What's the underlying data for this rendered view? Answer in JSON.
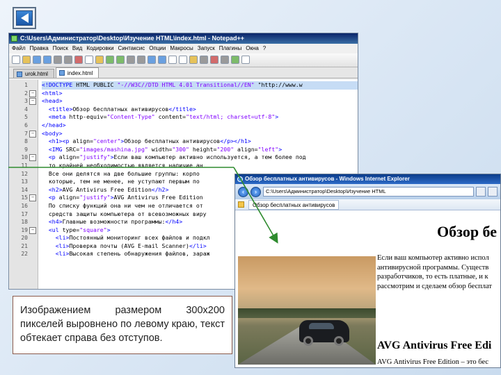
{
  "back_button": {
    "icon": "back-arrow-icon"
  },
  "notepad": {
    "title": "C:\\Users\\Администратор\\Desktop\\Изучение HTML\\index.html - Notepad++",
    "menu": [
      "Файл",
      "Правка",
      "Поиск",
      "Вид",
      "Кодировки",
      "Синтаксис",
      "Опции",
      "Макросы",
      "Запуск",
      "Плагины",
      "Окна",
      "?"
    ],
    "tabs": [
      "urok.html",
      "index.html"
    ],
    "active_tab": "index.html",
    "lines": [
      {
        "n": "1",
        "code": "<!DOCTYPE HTML PUBLIC \"-//W3C//DTD HTML 4.01 Transitional//EN\" \"http://www.w"
      },
      {
        "n": "2",
        "code": "<html>"
      },
      {
        "n": "3",
        "code": "<head>"
      },
      {
        "n": "4",
        "code": "  <title>Обзор бесплатных антивирусов</title>"
      },
      {
        "n": "5",
        "code": "  <meta http-equiv=\"Content-Type\" content=\"text/html; charset=utf-8\">"
      },
      {
        "n": "6",
        "code": "</head>"
      },
      {
        "n": "7",
        "code": "<body>"
      },
      {
        "n": "8",
        "code": "  <h1><p align=\"center\">Обзор бесплатных антивирусов</p></h1>"
      },
      {
        "n": "9",
        "code": "  <IMG SRC=\"images/mashina.jpg\" width=\"300\" height=\"200\" align=\"left\">"
      },
      {
        "n": "10",
        "code": "  <p align=\"justify\">Если ваш компьютер активно используется, а тем более под"
      },
      {
        "n": "11",
        "code": "  то крайней необходимостью является наличие ан"
      },
      {
        "n": "12",
        "code": "  Все они делятся на две большие группы: корпо"
      },
      {
        "n": "13",
        "code": "  которые, тем не менее, не уступают первым по "
      },
      {
        "n": "14",
        "code": "  <h2>AVG Antivirus Free Edition</h2>"
      },
      {
        "n": "15",
        "code": "  <p align=\"justify\">AVG Antivirus Free Edition"
      },
      {
        "n": "16",
        "code": "  По списку функций она ни чем не отличается от"
      },
      {
        "n": "17",
        "code": "  средств защиты компьютера от всевозможных виру"
      },
      {
        "n": "18",
        "code": "  <h4>Главные возможности программы:</h4>"
      },
      {
        "n": "19",
        "code": "  <ul type=\"square\">"
      },
      {
        "n": "20",
        "code": "    <li>Постоянный мониторинг всех файлов и подкл"
      },
      {
        "n": "21",
        "code": "    <li>Проверка почты (AVG E-mail Scanner)</li>"
      },
      {
        "n": "22",
        "code": "    <li>Высокая степень обнаружения файлов, зараж"
      }
    ]
  },
  "ie": {
    "title": "Обзор бесплатных антивирусов - Windows Internet Explorer",
    "address": "C:\\Users\\Администратор\\Desktop\\Изучение HTML",
    "tab_title": "Обзор бесплатных антивирусов",
    "heading": "Обзор бе",
    "para1": [
      "Если ваш компьютер активно испол",
      "антивирусной программы. Существ",
      "разработчиков, то есть платные, и к",
      "рассмотрим и сделаем обзор бесплат"
    ],
    "heading2": "AVG Antivirus Free Edi",
    "para2": [
      "AVG Antivirus Free Edition – это бес",
      "не отличается от большинства плат",
      "вирусов."
    ]
  },
  "caption": "Изображением размером 300х200 пикселей выровнено по левому краю, текст обтекает справа без отступов.",
  "colors": {
    "arrow": "#2e8b2e",
    "caption_border": "#8b5a4a"
  }
}
